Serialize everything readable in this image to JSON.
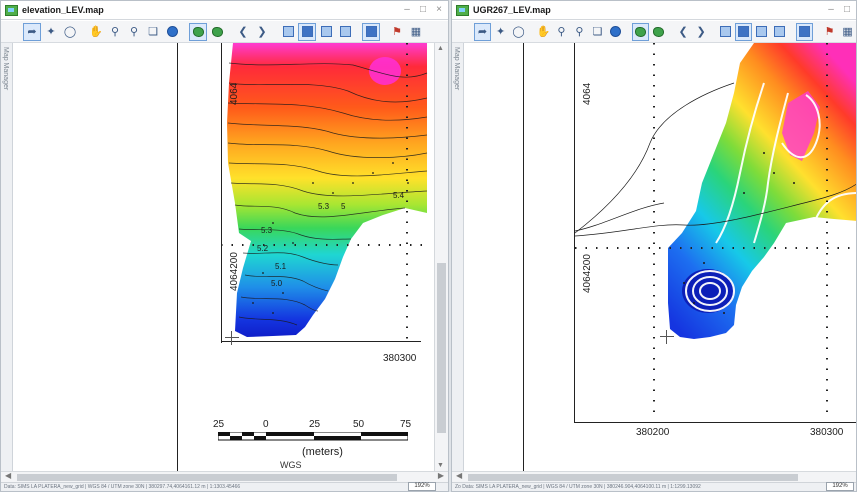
{
  "left": {
    "title": "elevation_LEV.map",
    "controls": [
      "–",
      "□",
      "×"
    ],
    "side_tab": "Map Manager",
    "axis": {
      "y_label": "4064200",
      "y_label_top": "4064",
      "x_label": "380300"
    },
    "contour_labels": [
      "5.3",
      "5",
      "5.4",
      "5.3",
      "5.2",
      "5.1",
      "5.0"
    ],
    "scalebar": {
      "ticks": [
        "25",
        "0",
        "25",
        "50",
        "75"
      ],
      "units": "(meters)",
      "crs": "WGS 84 / UTM zone 30N"
    },
    "status": "Data: SIMS LA PLATERA_new_grid  |  WGS 84 / UTM zone 30N  |  380297.74,4064161.12 m  |  1:1303.45466",
    "zoom": "192%"
  },
  "right": {
    "title": "UGR267_LEV.map",
    "controls": [
      "–",
      "□"
    ],
    "side_tab": "Map Manager",
    "axis": {
      "y_label": "4064200",
      "y_label_top": "4064",
      "x_left": "380200",
      "x_right": "380300"
    },
    "status": "Data: SIMS LA PLATERA_new_grid  |  WGS 84 / UTM zone 30N  |  380246.904,4064100.11 m  |  1:1299.13092",
    "status_prefix": "Zo",
    "zoom": "192%"
  },
  "colors": {
    "accent": "#3c5a85",
    "active_tool": "#dbe9fb"
  }
}
